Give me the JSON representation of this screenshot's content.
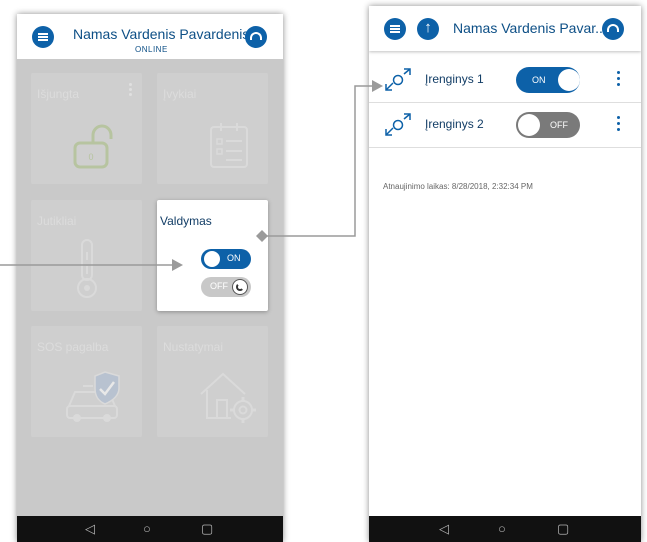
{
  "left_screen": {
    "header": {
      "title": "Namas Vardenis Pavardenis",
      "subtitle": "ONLINE"
    },
    "tiles": [
      {
        "label": "Išjungta",
        "icon": "unlocked-padlock-icon"
      },
      {
        "label": "Įvykiai",
        "icon": "calendar-list-icon"
      },
      {
        "label": "Jutikliai",
        "icon": "thermometer-sensor-icon"
      },
      {
        "label": "Valdymas",
        "icon": "toggle-icon"
      },
      {
        "label": "SOS pagalba",
        "icon": "security-car-icon"
      },
      {
        "label": "Nustatymai",
        "icon": "house-gear-icon"
      }
    ],
    "valdymas": {
      "on_label": "ON",
      "off_label": "OFF"
    }
  },
  "right_screen": {
    "header": {
      "title": "Namas Vardenis Pavar..."
    },
    "devices": [
      {
        "label": "Įrenginys 1",
        "state": "ON"
      },
      {
        "label": "Įrenginys 2",
        "state": "OFF"
      }
    ],
    "update_text": "Atnaujinimo laikas: 8/28/2018, 2:32:34 PM"
  },
  "colors": {
    "accent": "#0d61a8",
    "title": "#0d4f86",
    "dim_background": "#c9c9c9",
    "navbar": "#111111"
  }
}
